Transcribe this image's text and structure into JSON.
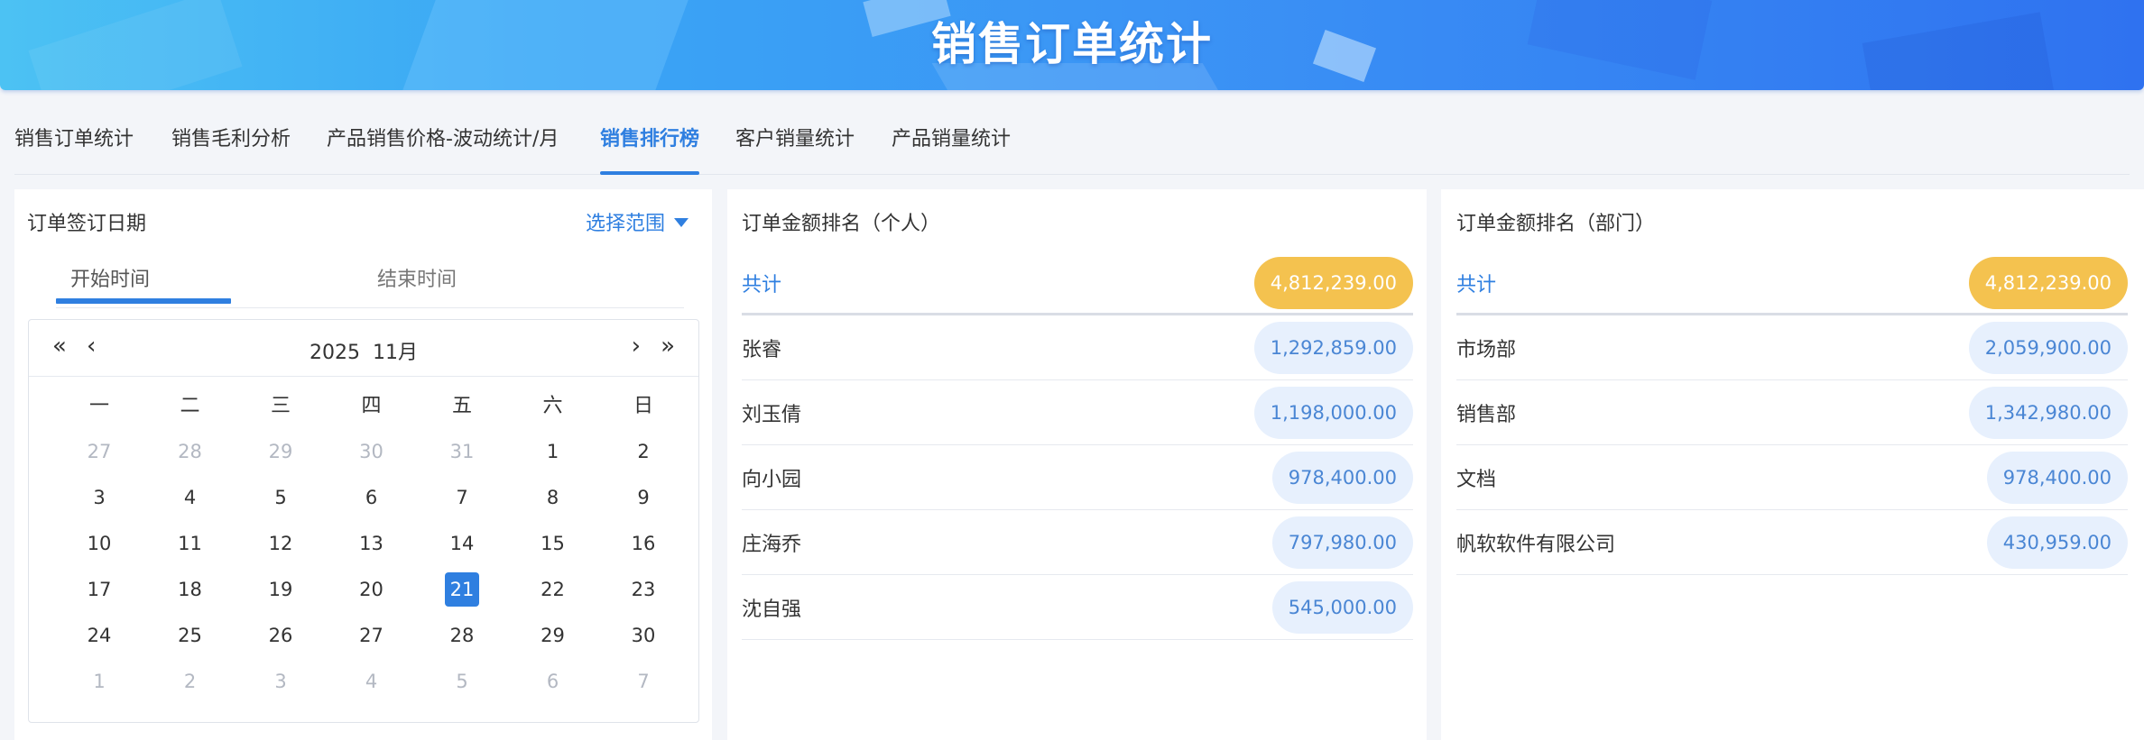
{
  "header": {
    "title": "销售订单统计"
  },
  "tabs": [
    {
      "label": "销售订单统计"
    },
    {
      "label": "销售毛利分析"
    },
    {
      "label": "产品销售价格-波动统计/月"
    },
    {
      "label": "销售排行榜"
    },
    {
      "label": "客户销量统计"
    },
    {
      "label": "产品销量统计"
    }
  ],
  "active_tab": "销售排行榜",
  "colors": {
    "accent": "#2f7fe0",
    "total_pill": "#f4c24f",
    "pill_bg": "#e7f0fd",
    "banner_start": "#4cc2f3",
    "banner_end": "#2f72f0"
  },
  "date_panel": {
    "title": "订单签订日期",
    "range_label": "选择范围",
    "start_tab": "开始时间",
    "end_tab": "结束时间",
    "calendar": {
      "year": "2025",
      "month": "11月",
      "nav": {
        "prev_year": "«",
        "prev_month": "‹",
        "next_month": "›",
        "next_year": "»"
      },
      "weekdays": [
        "一",
        "二",
        "三",
        "四",
        "五",
        "六",
        "日"
      ],
      "weeks": [
        [
          "27",
          "28",
          "29",
          "30",
          "31",
          "1",
          "2"
        ],
        [
          "3",
          "4",
          "5",
          "6",
          "7",
          "8",
          "9"
        ],
        [
          "10",
          "11",
          "12",
          "13",
          "14",
          "15",
          "16"
        ],
        [
          "17",
          "18",
          "19",
          "20",
          "21",
          "22",
          "23"
        ],
        [
          "24",
          "25",
          "26",
          "27",
          "28",
          "29",
          "30"
        ],
        [
          "1",
          "2",
          "3",
          "4",
          "5",
          "6",
          "7"
        ]
      ],
      "selected_day": "21"
    }
  },
  "personal_ranking": {
    "title": "订单金额排名（个人）",
    "total": {
      "label": "共计",
      "value": "4,812,239.00"
    },
    "rows": [
      {
        "name": "张睿",
        "value": "1,292,859.00"
      },
      {
        "name": "刘玉倩",
        "value": "1,198,000.00"
      },
      {
        "name": "向小园",
        "value": "978,400.00"
      },
      {
        "name": "庄海乔",
        "value": "797,980.00"
      },
      {
        "name": "沈自强",
        "value": "545,000.00"
      }
    ]
  },
  "department_ranking": {
    "title": "订单金额排名（部门）",
    "total": {
      "label": "共计",
      "value": "4,812,239.00"
    },
    "rows": [
      {
        "name": "市场部",
        "value": "2,059,900.00"
      },
      {
        "name": "销售部",
        "value": "1,342,980.00"
      },
      {
        "name": "文档",
        "value": "978,400.00"
      },
      {
        "name": "帆软软件有限公司",
        "value": "430,959.00"
      }
    ]
  }
}
